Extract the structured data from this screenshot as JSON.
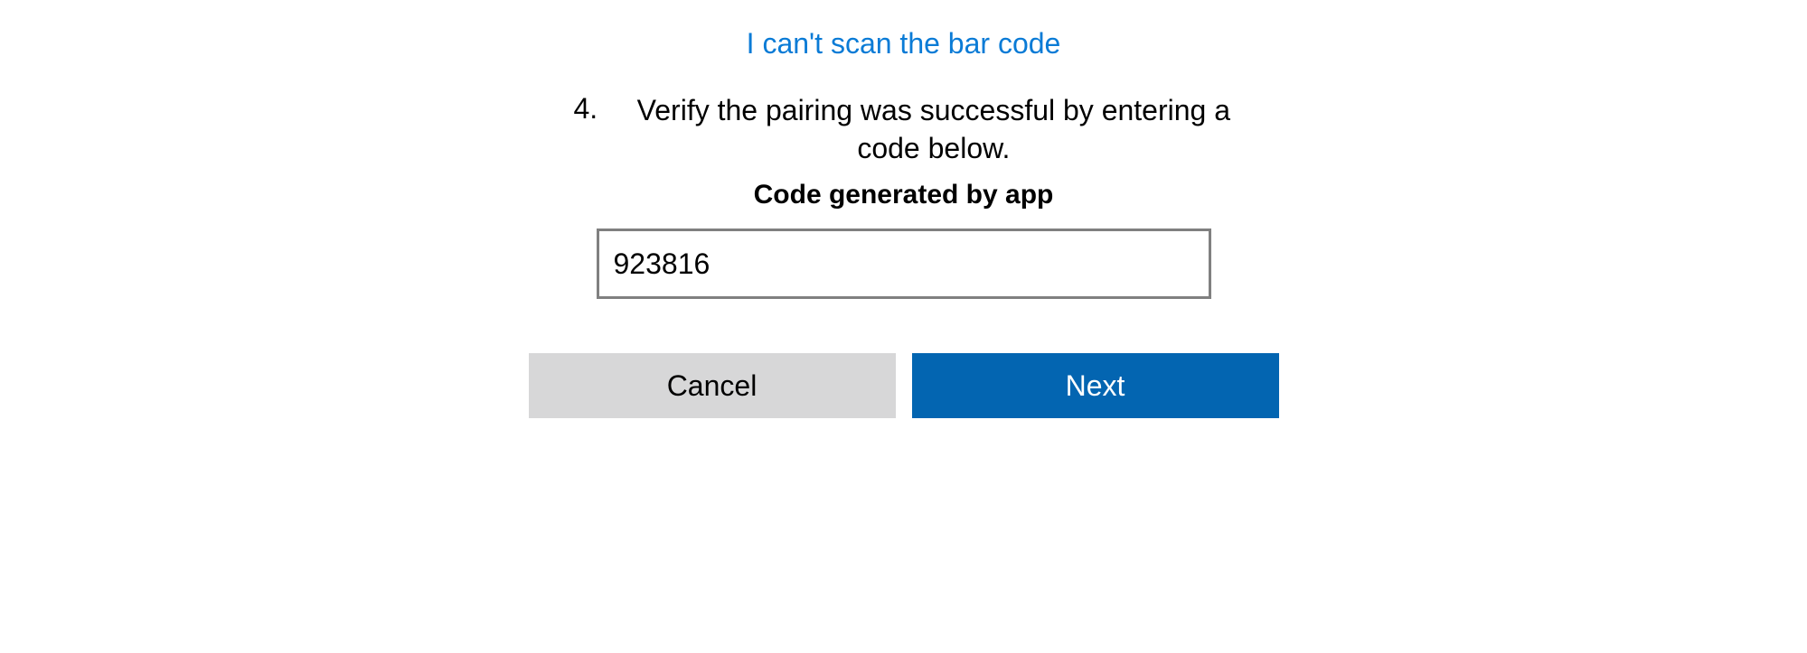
{
  "link_text": "I can't scan the bar code",
  "step": {
    "number": "4.",
    "text": "Verify the pairing was successful by entering a code below."
  },
  "field_label": "Code generated by app",
  "code_input": {
    "value": "923816"
  },
  "buttons": {
    "cancel": "Cancel",
    "next": "Next"
  }
}
